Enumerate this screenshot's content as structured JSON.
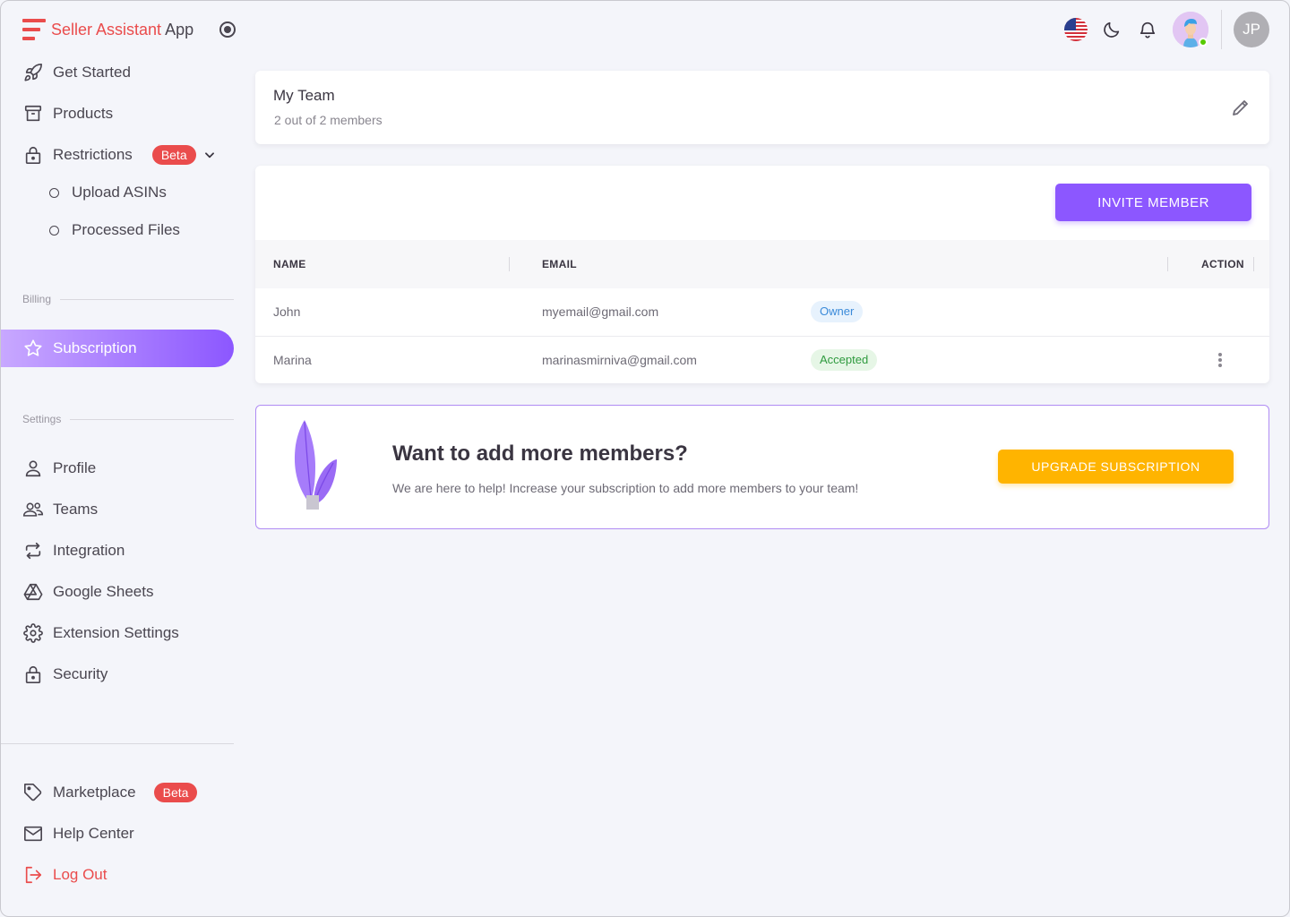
{
  "brand": {
    "title_part1": "Seller Assistant",
    "title_part2": "App",
    "logo_color": "#ea4c4c"
  },
  "sidebar": {
    "items": [
      {
        "label": "Get Started",
        "icon": "rocket-icon"
      },
      {
        "label": "Products",
        "icon": "archive-icon"
      },
      {
        "label": "Restrictions",
        "icon": "lock-icon",
        "badge": "Beta"
      },
      {
        "label": "Upload ASINs",
        "icon": "circle-outline-icon"
      },
      {
        "label": "Processed Files",
        "icon": "circle-outline-icon"
      }
    ],
    "billing_label": "Billing",
    "billing_items": [
      {
        "label": "Subscription",
        "icon": "star-icon",
        "active": true
      }
    ],
    "settings_label": "Settings",
    "settings_items": [
      {
        "label": "Profile",
        "icon": "user-icon"
      },
      {
        "label": "Teams",
        "icon": "users-icon"
      },
      {
        "label": "Integration",
        "icon": "repeat-icon"
      },
      {
        "label": "Google Sheets",
        "icon": "drive-icon"
      },
      {
        "label": "Extension Settings",
        "icon": "gear-icon"
      },
      {
        "label": "Security",
        "icon": "lock-icon"
      }
    ],
    "footer_items": [
      {
        "label": "Marketplace",
        "icon": "tag-icon",
        "badge": "Beta"
      },
      {
        "label": "Help Center",
        "icon": "mail-icon"
      },
      {
        "label": "Log Out",
        "icon": "logout-icon"
      }
    ]
  },
  "topbar": {
    "user_initials": "JP"
  },
  "team": {
    "title": "My Team",
    "subtitle": "2 out of 2 members"
  },
  "members": {
    "invite_label": "INVITE MEMBER",
    "columns": [
      "NAME",
      "EMAIL",
      "ACTION"
    ],
    "rows": [
      {
        "name": "John",
        "email": "myemail@gmail.com",
        "status": "Owner"
      },
      {
        "name": "Marina",
        "email": "marinasmirniva@gmail.com",
        "status": "Accepted"
      }
    ]
  },
  "upgrade": {
    "title": "Want to add more members?",
    "subtitle": "We are here to help! Increase your subscription to add more members to your team!",
    "button_label": "UPGRADE SUBSCRIPTION"
  },
  "colors": {
    "primary": "#8c57ff",
    "warning": "#ffb400",
    "danger": "#ea4c4c"
  }
}
